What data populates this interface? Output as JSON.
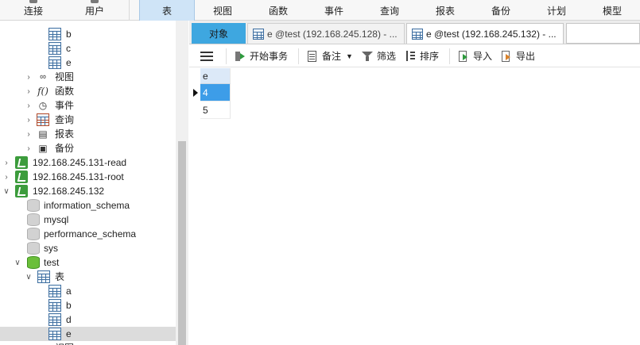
{
  "toolbar": {
    "items": [
      {
        "label": "连接"
      },
      {
        "label": "用户"
      },
      {
        "label": "表"
      },
      {
        "label": "视图"
      },
      {
        "label": "函数"
      },
      {
        "label": "事件"
      },
      {
        "label": "查询"
      },
      {
        "label": "报表"
      },
      {
        "label": "备份"
      },
      {
        "label": "计划"
      },
      {
        "label": "模型"
      }
    ],
    "active": "表"
  },
  "nav": {
    "rows": [
      {
        "label": "b",
        "icon": "table-icon"
      },
      {
        "label": "c",
        "icon": "table-icon"
      },
      {
        "label": "e",
        "icon": "table-icon"
      },
      {
        "label": "视图",
        "icon": "view-icon"
      },
      {
        "label": "函数",
        "icon": "function-icon"
      },
      {
        "label": "事件",
        "icon": "event-icon"
      },
      {
        "label": "查询",
        "icon": "query-icon"
      },
      {
        "label": "报表",
        "icon": "report-icon"
      },
      {
        "label": "备份",
        "icon": "backup-icon"
      },
      {
        "label": "192.168.245.131-read",
        "icon": "connection-icon"
      },
      {
        "label": "192.168.245.131-root",
        "icon": "connection-icon"
      },
      {
        "label": "192.168.245.132",
        "icon": "connection-icon"
      },
      {
        "label": "information_schema",
        "icon": "database-icon"
      },
      {
        "label": "mysql",
        "icon": "database-icon"
      },
      {
        "label": "performance_schema",
        "icon": "database-icon"
      },
      {
        "label": "sys",
        "icon": "database-icon"
      },
      {
        "label": "test",
        "icon": "database-open-icon"
      },
      {
        "label": "表",
        "icon": "tables-folder-icon"
      },
      {
        "label": "a",
        "icon": "table-icon"
      },
      {
        "label": "b",
        "icon": "table-icon"
      },
      {
        "label": "d",
        "icon": "table-icon"
      },
      {
        "label": "e",
        "icon": "table-icon"
      },
      {
        "label": "视图",
        "icon": "view-icon"
      }
    ]
  },
  "tabs": {
    "objects": "对象",
    "tab1": "e @test (192.168.245.128) - ...",
    "tab2": "e @test (192.168.245.132) - ..."
  },
  "actions": {
    "begin_transaction": "开始事务",
    "memo": "备注",
    "filter": "筛选",
    "sort": "排序",
    "import": "导入",
    "export": "导出"
  },
  "grid": {
    "column": "e",
    "rows": [
      "4",
      "5"
    ],
    "selected_row": 0
  }
}
